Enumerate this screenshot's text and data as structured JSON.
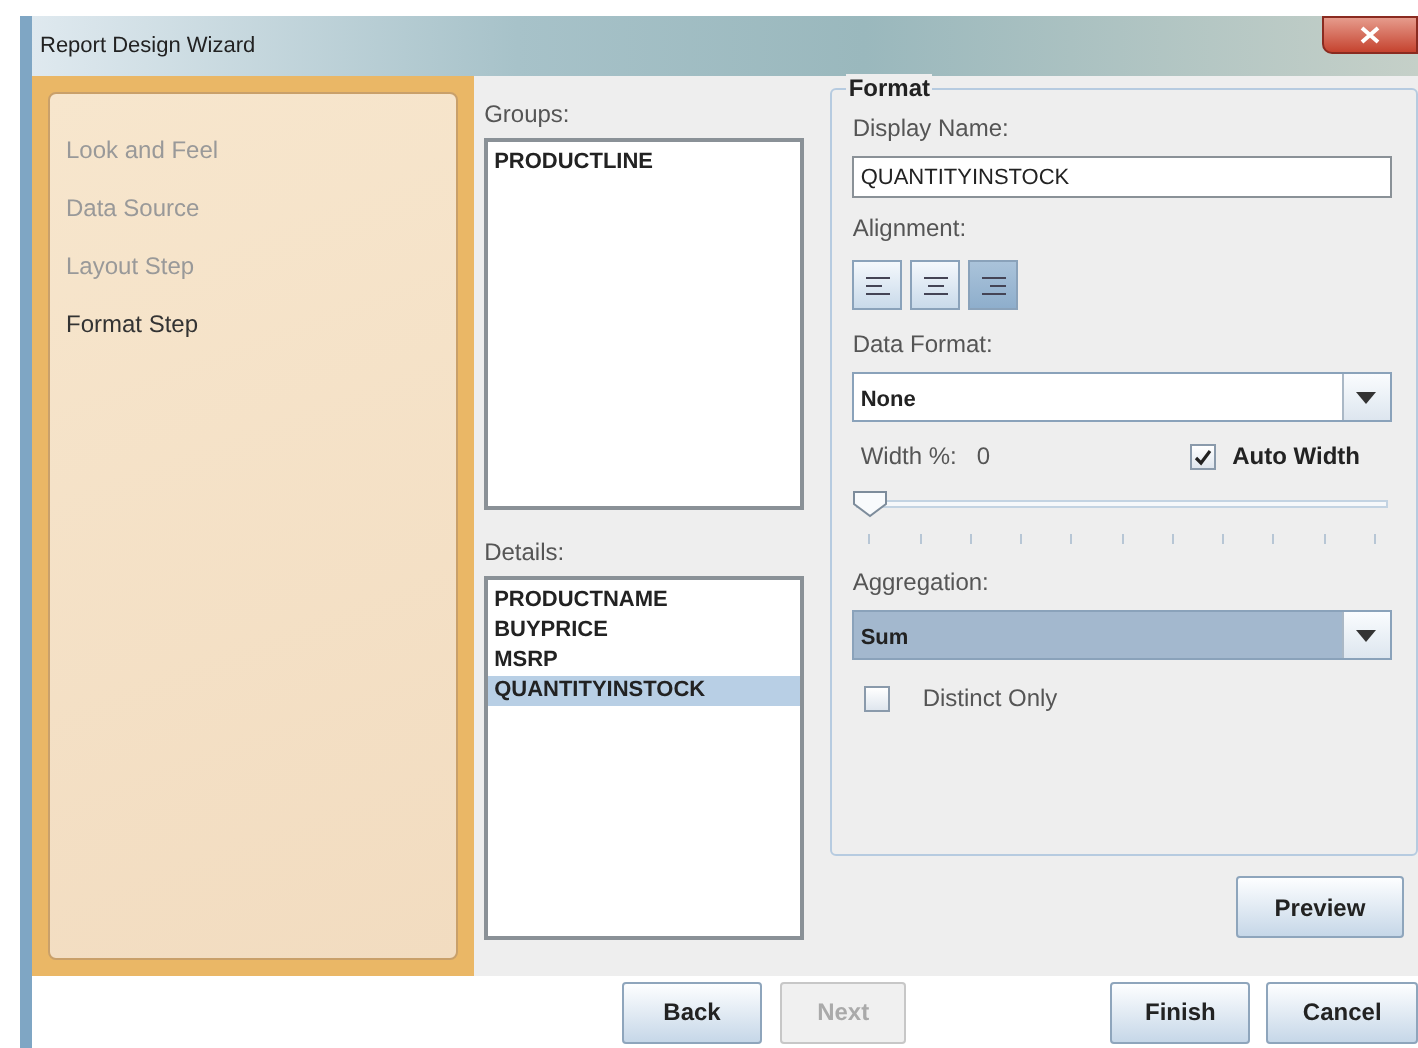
{
  "window": {
    "title": "Report Design Wizard"
  },
  "steps": [
    {
      "label": "Look and Feel",
      "selected": false
    },
    {
      "label": "Data Source",
      "selected": false
    },
    {
      "label": "Layout Step",
      "selected": false
    },
    {
      "label": "Format Step",
      "selected": true
    }
  ],
  "groups": {
    "label": "Groups:",
    "items": [
      {
        "text": "PRODUCTLINE",
        "selected": false
      }
    ]
  },
  "details": {
    "label": "Details:",
    "items": [
      {
        "text": "PRODUCTNAME",
        "selected": false
      },
      {
        "text": "BUYPRICE",
        "selected": false
      },
      {
        "text": "MSRP",
        "selected": false
      },
      {
        "text": "QUANTITYINSTOCK",
        "selected": true
      }
    ]
  },
  "format": {
    "title": "Format",
    "display_name": {
      "label": "Display Name:",
      "value": "QUANTITYINSTOCK"
    },
    "alignment": {
      "label": "Alignment:",
      "options": [
        {
          "kind": "left",
          "selected": false
        },
        {
          "kind": "center",
          "selected": false
        },
        {
          "kind": "right",
          "selected": true
        }
      ]
    },
    "data_format": {
      "label": "Data Format:",
      "value": "None",
      "highlighted": false
    },
    "width": {
      "label": "Width %:",
      "reading": "0",
      "level": 0
    },
    "auto_width": {
      "label": "Auto Width",
      "checked": true
    },
    "aggregation": {
      "label": "Aggregation:",
      "value": "Sum",
      "highlighted": true
    },
    "distinct_only": {
      "label": "Distinct Only",
      "checked": false
    }
  },
  "preview_button": {
    "label": "Preview",
    "disabled": false
  },
  "buttons": [
    {
      "label": "Back",
      "disabled": false
    },
    {
      "label": "Next",
      "disabled": true
    },
    {
      "label": "Finish",
      "disabled": false
    },
    {
      "label": "Cancel",
      "disabled": false
    }
  ]
}
